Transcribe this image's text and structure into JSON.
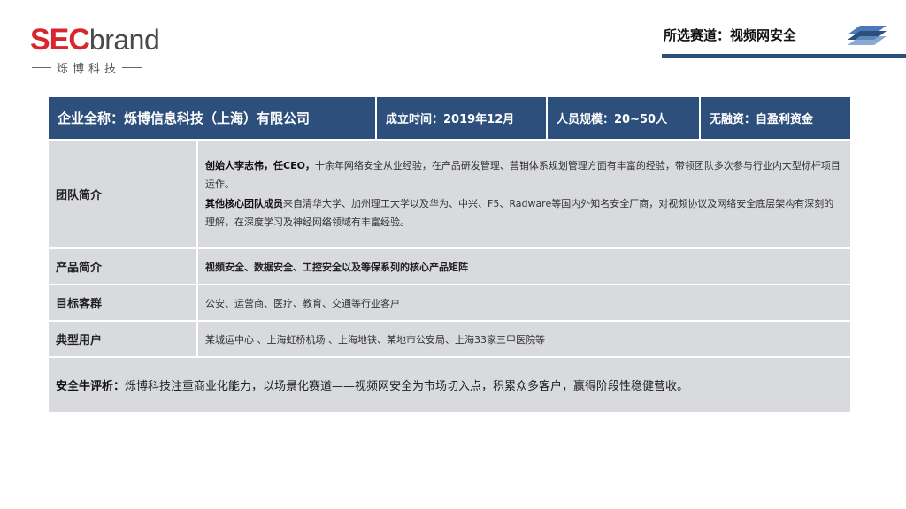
{
  "logo": {
    "sec": "SEC",
    "brand": "brand",
    "sub": "烁博科技"
  },
  "header": {
    "track": "所选赛道：视频网安全"
  },
  "table": {
    "company": "企业全称：烁博信息科技（上海）有限公司",
    "founded": "成立时间：2019年12月",
    "staff": "人员规模：20~50人",
    "funding": "无融资：自盈利资金",
    "team": {
      "label": "团队简介",
      "founder_name": "创始人李志伟，任CEO，",
      "founder_desc": "十余年网络安全从业经验，在产品研发管理、营销体系规划管理方面有丰富的经验，带领团队多次参与行业内大型标杆项目运作。",
      "core_name": "其他核心团队成员",
      "core_desc": "来自清华大学、加州理工大学以及华为、中兴、F5、Radware等国内外知名安全厂商，对视频协议及网络安全底层架构有深刻的理解，在深度学习及神经网络领域有丰富经验。"
    },
    "product": {
      "label": "产品简介",
      "text": "视频安全、数据安全、工控安全以及等保系列的核心产品矩阵"
    },
    "target": {
      "label": "目标客群",
      "text": "公安、运营商、医疗、教育、交通等行业客户"
    },
    "users": {
      "label": "典型用户",
      "text": "某城运中心 、上海虹桥机场 、上海地铁、某地市公安局、上海33家三甲医院等"
    },
    "evaluation": {
      "label": "安全牛评析：",
      "text": "烁博科技注重商业化能力，以场景化赛道——视频网安全为市场切入点，积累众多客户，赢得阶段性稳健营收。"
    }
  },
  "colors": {
    "brand_red": "#d9262e",
    "header_blue": "#2c4f7c",
    "row_gray": "#d9dade"
  }
}
